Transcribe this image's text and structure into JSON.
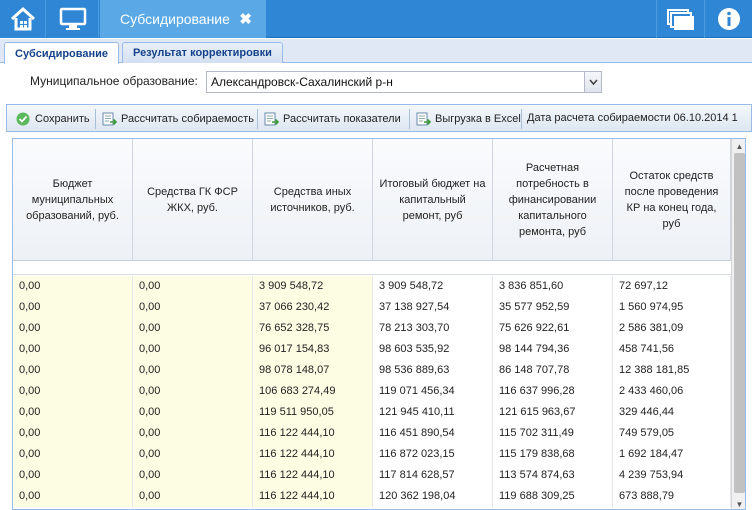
{
  "topbar": {
    "active_tab_label": "Субсидирование",
    "close_glyph": "✖",
    "icons": [
      "home-icon",
      "desktop-icon",
      "windows-icon",
      "info-icon"
    ],
    "accent": "#2e86d4"
  },
  "subtabs": [
    "Субсидирование",
    "Результат корректировки"
  ],
  "form": {
    "municipality_label": "Муниципальное образование:",
    "municipality_value": "Александровск-Сахалинский р-н"
  },
  "toolbar": {
    "save_label": "Сохранить",
    "calc_collect_label": "Рассчитать собираемость",
    "calc_indicators_label": "Рассчитать показатели",
    "export_excel_label": "Выгрузка в Excel",
    "calc_date_text": "Дата расчета собираемости 06.10.2014 1"
  },
  "grid": {
    "columns": [
      "Бюджет муниципальных образований, руб.",
      "Средства ГК ФСР ЖКХ, руб.",
      "Средства иных источников, руб.",
      "Итоговый бюджет на капитальный ремонт, руб",
      "Расчетная потребность в финансировании капитального ремонта, руб",
      "Остаток средств после проведения КР на конец года, руб"
    ],
    "rows": [
      [
        "0,00",
        "0,00",
        "3 909 548,72",
        "3 909 548,72",
        "3 836 851,60",
        "72 697,12"
      ],
      [
        "0,00",
        "0,00",
        "37 066 230,42",
        "37 138 927,54",
        "35 577 952,59",
        "1 560 974,95"
      ],
      [
        "0,00",
        "0,00",
        "76 652 328,75",
        "78 213 303,70",
        "75 626 922,61",
        "2 586 381,09"
      ],
      [
        "0,00",
        "0,00",
        "96 017 154,83",
        "98 603 535,92",
        "98 144 794,36",
        "458 741,56"
      ],
      [
        "0,00",
        "0,00",
        "98 078 148,07",
        "98 536 889,63",
        "86 148 707,78",
        "12 388 181,85"
      ],
      [
        "0,00",
        "0,00",
        "106 683 274,49",
        "119 071 456,34",
        "116 637 996,28",
        "2 433 460,06"
      ],
      [
        "0,00",
        "0,00",
        "119 511 950,05",
        "121 945 410,11",
        "121 615 963,67",
        "329 446,44"
      ],
      [
        "0,00",
        "0,00",
        "116 122 444,10",
        "116 451 890,54",
        "115 702 311,49",
        "749 579,05"
      ],
      [
        "0,00",
        "0,00",
        "116 122 444,10",
        "116 872 023,15",
        "115 179 838,68",
        "1 692 184,47"
      ],
      [
        "0,00",
        "0,00",
        "116 122 444,10",
        "117 814 628,57",
        "113 574 874,63",
        "4 239 753,94"
      ],
      [
        "0,00",
        "0,00",
        "116 122 444,10",
        "120 362 198,04",
        "119 688 309,25",
        "673 888,79"
      ]
    ]
  }
}
